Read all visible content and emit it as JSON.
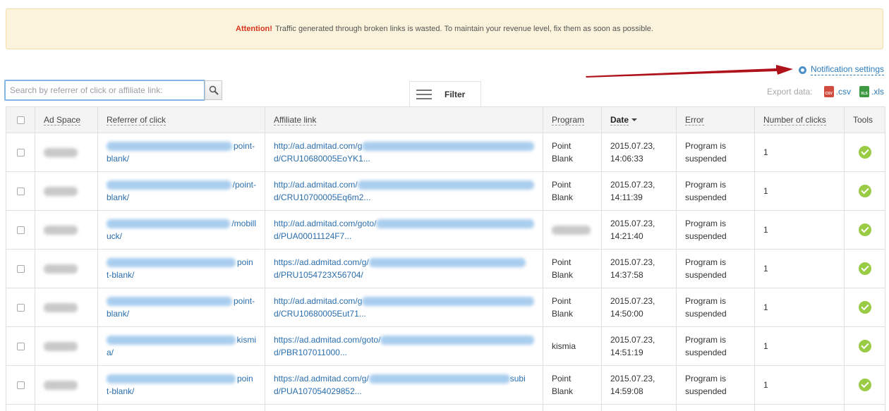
{
  "alert": {
    "strong": "Attention!",
    "text": "Traffic generated through broken links is wasted. To maintain your revenue level, fix them as soon as possible."
  },
  "notification": {
    "label": "Notification settings",
    "icon": "gear-icon"
  },
  "search": {
    "placeholder": "Search by referrer of click or affiliate link:",
    "value": ""
  },
  "filter": {
    "label": "Filter"
  },
  "export": {
    "label": "Export data:",
    "csv": ".csv",
    "xls": ".xls",
    "csv_badge": "CSV",
    "xls_badge": "XLS"
  },
  "colors": {
    "accent": "#2e7bb6",
    "alert_bg": "#fcf3dd",
    "alert_strong": "#d9341c",
    "ok": "#9acb45",
    "arrow": "#b0121b"
  },
  "table": {
    "headers": {
      "ad_space": "Ad Space",
      "referrer": "Referrer of click",
      "affiliate": "Affiliate link",
      "program": "Program",
      "date": "Date",
      "error": "Error",
      "clicks": "Number of clicks",
      "tools": "Tools"
    },
    "sort": {
      "column": "date",
      "direction": "desc"
    },
    "rows": [
      {
        "ref_end": "point-",
        "ref2": "blank/",
        "aff1": "http://ad.admitad.com/g",
        "aff1_end": "",
        "aff2": "d/CRU10680005EoYK1...",
        "program1": "Point",
        "program2": "Blank",
        "date1": "2015.07.23,",
        "date2": "14:06:33",
        "error1": "Program is",
        "error2": "suspended",
        "clicks": "1"
      },
      {
        "ref_end": "/point-",
        "ref2": "blank/",
        "aff1": "http://ad.admitad.com/",
        "aff1_end": "",
        "aff2": "d/CRU10700005Eq6m2...",
        "program1": "Point",
        "program2": "Blank",
        "date1": "2015.07.23,",
        "date2": "14:11:39",
        "error1": "Program is",
        "error2": "suspended",
        "clicks": "1"
      },
      {
        "ref_end": "/mobill",
        "ref2": "uck/",
        "aff1": "http://ad.admitad.com/goto/",
        "aff1_end": "",
        "aff2": "d/PUA00011124F7...",
        "program1": "",
        "program2": "",
        "date1": "2015.07.23,",
        "date2": "14:21:40",
        "error1": "Program is",
        "error2": "suspended",
        "clicks": "1"
      },
      {
        "ref_end": "poin",
        "ref2": "t-blank/",
        "aff1": "https://ad.admitad.com/g/",
        "aff1_end": "",
        "aff2": "d/PRU1054723X56704/",
        "program1": "Point",
        "program2": "Blank",
        "date1": "2015.07.23,",
        "date2": "14:37:58",
        "error1": "Program is",
        "error2": "suspended",
        "clicks": "1"
      },
      {
        "ref_end": "point-",
        "ref2": "blank/",
        "aff1": "http://ad.admitad.com/g",
        "aff1_end": "",
        "aff2": "d/CRU10680005Eut71...",
        "program1": "Point",
        "program2": "Blank",
        "date1": "2015.07.23,",
        "date2": "14:50:00",
        "error1": "Program is",
        "error2": "suspended",
        "clicks": "1"
      },
      {
        "ref_end": "kismi",
        "ref2": "a/",
        "aff1": "https://ad.admitad.com/goto/",
        "aff1_end": "",
        "aff2": "d/PBR107011000...",
        "program1": "kismia",
        "program2": "",
        "date1": "2015.07.23,",
        "date2": "14:51:19",
        "error1": "Program is",
        "error2": "suspended",
        "clicks": "1"
      },
      {
        "ref_end": "poin",
        "ref2": "t-blank/",
        "aff1": "https://ad.admitad.com/g/",
        "aff1_end": "subi",
        "aff2": "d/PUA107054029852...",
        "program1": "Point",
        "program2": "Blank",
        "date1": "2015.07.23,",
        "date2": "14:59:08",
        "error1": "Program is",
        "error2": "suspended",
        "clicks": "1"
      }
    ]
  }
}
